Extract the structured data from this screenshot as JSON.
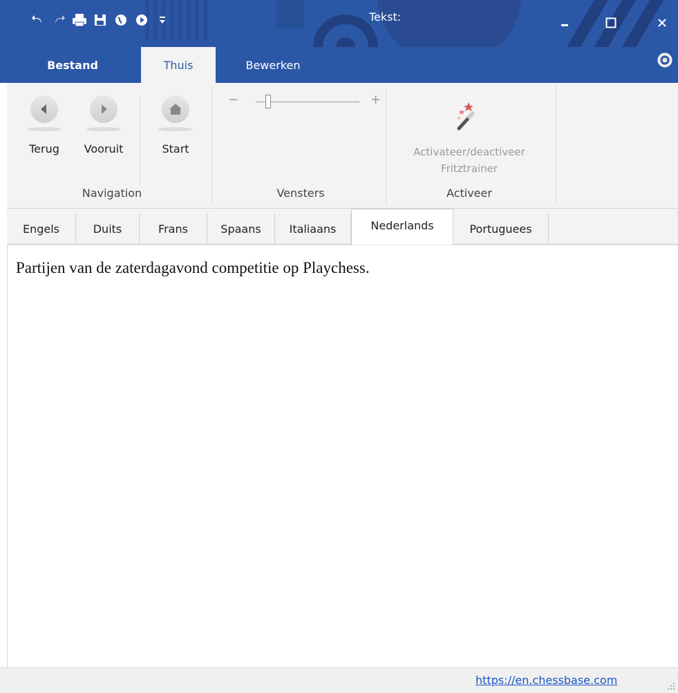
{
  "window": {
    "title": "Tekst:",
    "colors": {
      "titlebar": "#2b57a7",
      "ribbon": "#f3f3f3",
      "link": "#1a55c8"
    }
  },
  "quick_access": {
    "icons": [
      "undo-icon",
      "redo-icon",
      "print-icon",
      "save-icon",
      "globe-icon",
      "globe-play-icon",
      "customize-dropdown-icon"
    ]
  },
  "ribbon_tabs": [
    {
      "label": "Bestand"
    },
    {
      "label": "Thuis",
      "active": true
    },
    {
      "label": "Bewerken"
    }
  ],
  "ribbon": {
    "navigation": {
      "buttons": [
        {
          "label": "Terug",
          "icon": "arrow-left-icon"
        },
        {
          "label": "Vooruit",
          "icon": "arrow-right-icon"
        },
        {
          "label": "Start",
          "icon": "home-icon"
        }
      ],
      "group_label": "Navigation"
    },
    "vensters": {
      "zoom_minus": "−",
      "zoom_plus": "+",
      "group_label": "Vensters"
    },
    "activeer": {
      "button_label_line1": "Activateer/deactiveer",
      "button_label_line2": "Fritztrainer",
      "group_label": "Activeer"
    }
  },
  "language_tabs": [
    {
      "label": "Engels"
    },
    {
      "label": "Duits"
    },
    {
      "label": "Frans"
    },
    {
      "label": "Spaans"
    },
    {
      "label": "Italiaans"
    },
    {
      "label": "Nederlands",
      "active": true
    },
    {
      "label": "Portuguees"
    }
  ],
  "content": {
    "text": "Partijen van de zaterdagavond competitie op Playchess."
  },
  "status": {
    "link": "https://en.chessbase.com"
  }
}
